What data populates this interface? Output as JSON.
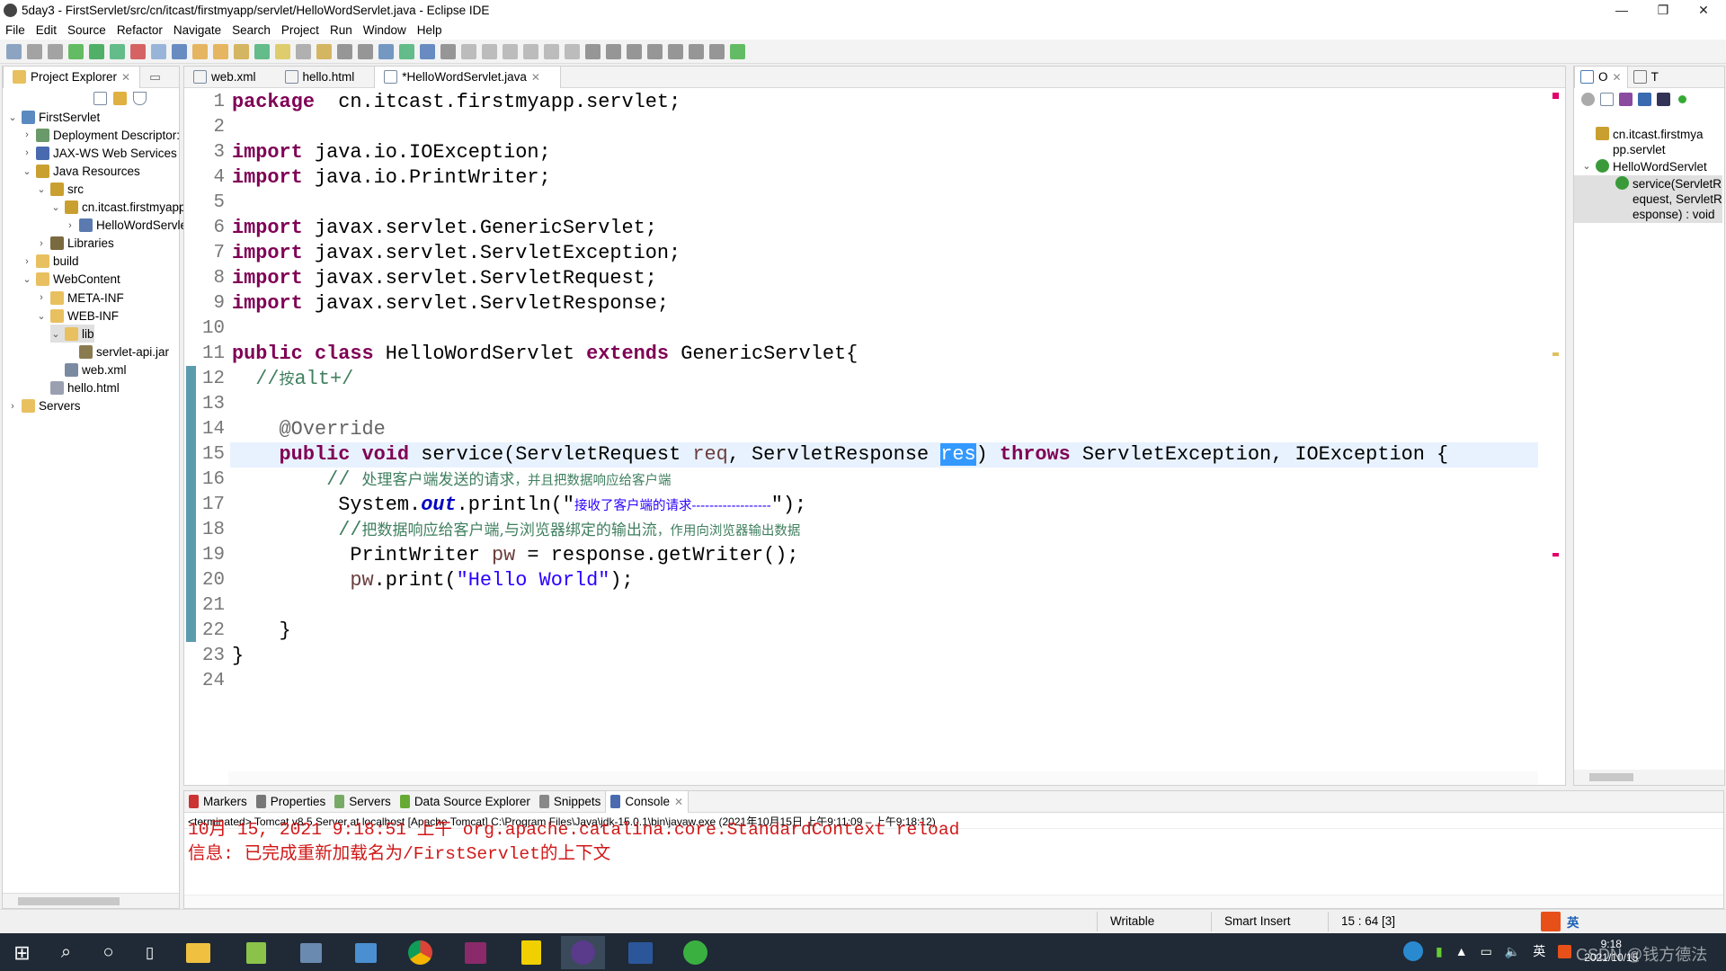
{
  "window": {
    "title": "5day3 - FirstServlet/src/cn/itcast/firstmyapp/servlet/HelloWordServlet.java - Eclipse IDE"
  },
  "menu": [
    "File",
    "Edit",
    "Source",
    "Refactor",
    "Navigate",
    "Search",
    "Project",
    "Run",
    "Window",
    "Help"
  ],
  "project_explorer": {
    "title": "Project Explorer",
    "items": [
      {
        "label": "FirstServlet",
        "level": 0,
        "exp": "v",
        "icon": "project-icon"
      },
      {
        "label": "Deployment Descriptor: FirstServlet",
        "level": 1,
        "exp": ">",
        "icon": "deployment-descriptor-icon"
      },
      {
        "label": "JAX-WS Web Services",
        "level": 1,
        "exp": ">",
        "icon": "web-services-icon"
      },
      {
        "label": "Java Resources",
        "level": 1,
        "exp": "v",
        "icon": "java-resources-icon"
      },
      {
        "label": "src",
        "level": 2,
        "exp": "v",
        "icon": "source-folder-icon"
      },
      {
        "label": "cn.itcast.firstmyapp.servlet",
        "level": 3,
        "exp": "v",
        "icon": "package-icon"
      },
      {
        "label": "HelloWordServlet.java",
        "level": 4,
        "exp": ">",
        "icon": "java-file-icon"
      },
      {
        "label": "Libraries",
        "level": 2,
        "exp": ">",
        "icon": "libraries-icon"
      },
      {
        "label": "build",
        "level": 1,
        "exp": ">",
        "icon": "folder-icon"
      },
      {
        "label": "WebContent",
        "level": 1,
        "exp": "v",
        "icon": "folder-icon"
      },
      {
        "label": "META-INF",
        "level": 2,
        "exp": ">",
        "icon": "folder-icon"
      },
      {
        "label": "WEB-INF",
        "level": 2,
        "exp": "v",
        "icon": "folder-icon"
      },
      {
        "label": "lib",
        "level": 3,
        "exp": "v",
        "icon": "folder-icon",
        "selected": true
      },
      {
        "label": "servlet-api.jar",
        "level": 4,
        "exp": "",
        "icon": "jar-icon"
      },
      {
        "label": "web.xml",
        "level": 3,
        "exp": "",
        "icon": "xml-file-icon"
      },
      {
        "label": "hello.html",
        "level": 2,
        "exp": "",
        "icon": "html-file-icon"
      },
      {
        "label": "Servers",
        "level": 0,
        "exp": ">",
        "icon": "folder-icon"
      }
    ]
  },
  "editor": {
    "tabs": [
      {
        "label": "web.xml",
        "active": false
      },
      {
        "label": "hello.html",
        "active": false
      },
      {
        "label": "*HelloWordServlet.java",
        "active": true
      }
    ],
    "current_line": 15,
    "lines": [
      [
        [
          "kw",
          "package"
        ],
        [
          "",
          "  cn.itcast.firstmyapp.servlet;"
        ]
      ],
      [],
      [
        [
          "kw",
          "import"
        ],
        [
          "",
          " java.io.IOException;"
        ]
      ],
      [
        [
          "kw",
          "import"
        ],
        [
          "",
          " java.io.PrintWriter;"
        ]
      ],
      [],
      [
        [
          "kw",
          "import"
        ],
        [
          "",
          " javax.servlet.GenericServlet;"
        ]
      ],
      [
        [
          "kw",
          "import"
        ],
        [
          "",
          " javax.servlet.ServletException;"
        ]
      ],
      [
        [
          "kw",
          "import"
        ],
        [
          "",
          " javax.servlet.ServletRequest;"
        ]
      ],
      [
        [
          "kw",
          "import"
        ],
        [
          "",
          " javax.servlet.ServletResponse;"
        ]
      ],
      [],
      [
        [
          "kw",
          "public class"
        ],
        [
          "",
          " HelloWordServlet "
        ],
        [
          "kw",
          "extends"
        ],
        [
          "",
          " GenericServlet{"
        ]
      ],
      [
        [
          "cmt",
          "  //"
        ],
        [
          "cmt cjk",
          "按"
        ],
        [
          "cmt",
          "alt+/"
        ]
      ],
      [],
      [
        [
          "ann",
          "    @Override"
        ]
      ],
      [
        [
          "kw",
          "    public void"
        ],
        [
          "",
          " service(ServletRequest "
        ],
        [
          "loc",
          "req"
        ],
        [
          "",
          ", ServletResponse "
        ],
        [
          "sel",
          "res"
        ],
        [
          "",
          ") "
        ],
        [
          "kw",
          "throws"
        ],
        [
          "",
          " ServletException, IOException {"
        ]
      ],
      [
        [
          "cmt",
          "        // "
        ],
        [
          "cmt cjk",
          "处理客户端发送的请求"
        ],
        [
          "cmt cjks",
          "，并且把数据响应给客户端"
        ]
      ],
      [
        [
          "",
          "         System."
        ],
        [
          "fld",
          "out"
        ],
        [
          "",
          ".println(\""
        ],
        [
          "str cjks",
          "接收了客户端的请求------------------"
        ],
        [
          "",
          "\");"
        ]
      ],
      [
        [
          "cmt",
          "         //"
        ],
        [
          "cmt cjk",
          "把数据响应给客户端,与浏览器绑定的输出流"
        ],
        [
          "cmt cjks",
          "，作用向浏览器输出数据"
        ]
      ],
      [
        [
          "",
          "          PrintWriter "
        ],
        [
          "loc",
          "pw"
        ],
        [
          "",
          " = response.getWriter();"
        ]
      ],
      [
        [
          "loc",
          "          pw"
        ],
        [
          "",
          ".print("
        ],
        [
          "str",
          "\"Hello World\""
        ],
        [
          "",
          ");"
        ]
      ],
      [],
      [
        [
          "",
          "    }"
        ]
      ],
      [
        [
          "",
          "}"
        ]
      ],
      []
    ]
  },
  "outline": {
    "tabs": [
      "O",
      "T"
    ],
    "items": [
      {
        "label": "cn.itcast.firstmyapp.servlet",
        "level": 0,
        "icon": "package-icon"
      },
      {
        "label": "HelloWordServlet",
        "level": 0,
        "icon": "class-icon",
        "exp": "v"
      },
      {
        "label": "service(ServletRequest, ServletResponse) : void",
        "level": 1,
        "icon": "method-icon",
        "selected": true
      }
    ]
  },
  "bottom": {
    "tabs": [
      {
        "label": "Markers"
      },
      {
        "label": "Properties"
      },
      {
        "label": "Servers"
      },
      {
        "label": "Data Source Explorer"
      },
      {
        "label": "Snippets"
      },
      {
        "label": "Console",
        "active": true
      }
    ],
    "console_header": "<terminated> Tomcat v8.5 Server at localhost [Apache Tomcat] C:\\Program Files\\Java\\jdk-15.0.1\\bin\\javaw.exe  (2021年10月15日 上午9:11:09 – 上午9:18:12)",
    "console_lines": [
      "10月 15, 2021 9:18:51 上午 org.apache.catalina.core.StandardContext reload",
      "信息: 已完成重新加载名为/FirstServlet的上下文"
    ]
  },
  "status": {
    "writable": "Writable",
    "insert_mode": "Smart Insert",
    "position": "15 : 64 [3]"
  },
  "taskbar": {
    "clock_time": "9:18",
    "clock_date": "2021/10/15",
    "ime": "英",
    "watermark": "CSDN @钱方德法"
  },
  "colors": {
    "keyword": "#7f0055",
    "string": "#2a00ff",
    "comment": "#3f7f5f",
    "console_error": "#d01818",
    "selection": "#3399ff"
  }
}
